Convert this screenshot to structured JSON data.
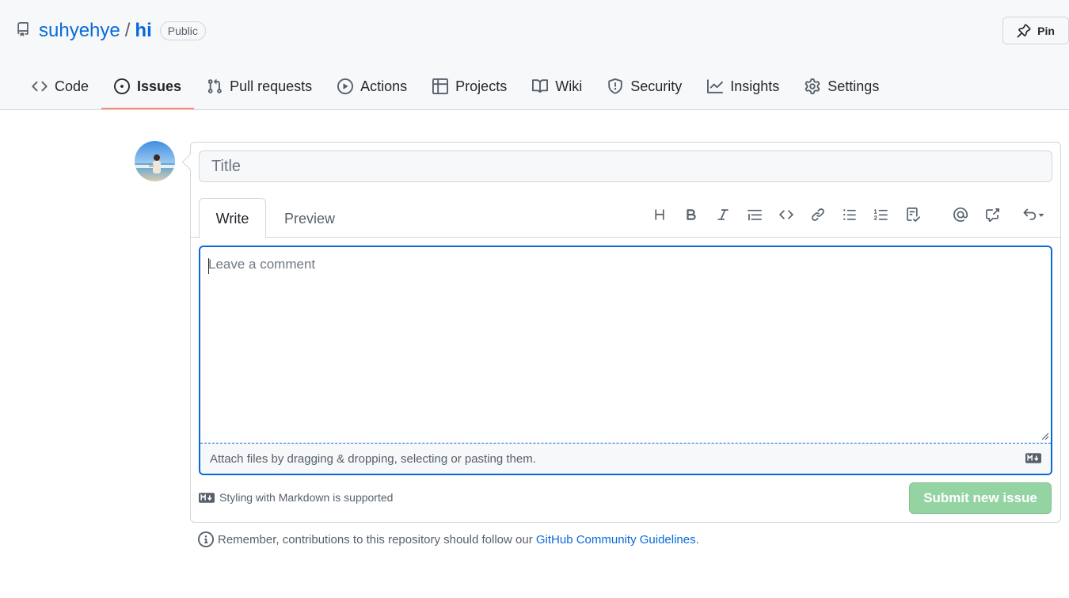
{
  "repo": {
    "owner": "suhyehye",
    "separator": "/",
    "name": "hi",
    "visibility": "Public",
    "pin_label": "Pin"
  },
  "nav": {
    "items": [
      {
        "label": "Code",
        "icon": "code-icon"
      },
      {
        "label": "Issues",
        "icon": "issue-opened-icon",
        "active": true
      },
      {
        "label": "Pull requests",
        "icon": "git-pull-request-icon"
      },
      {
        "label": "Actions",
        "icon": "play-icon"
      },
      {
        "label": "Projects",
        "icon": "table-icon"
      },
      {
        "label": "Wiki",
        "icon": "book-icon"
      },
      {
        "label": "Security",
        "icon": "shield-icon"
      },
      {
        "label": "Insights",
        "icon": "graph-icon"
      },
      {
        "label": "Settings",
        "icon": "gear-icon"
      }
    ]
  },
  "issue_form": {
    "title_placeholder": "Title",
    "tabs": {
      "write": "Write",
      "preview": "Preview"
    },
    "toolbar": [
      "heading-icon",
      "bold-icon",
      "italic-icon",
      "quote-icon",
      "code-icon",
      "link-icon",
      "bulleted-list-icon",
      "numbered-list-icon",
      "task-list-icon",
      "mention-icon",
      "cross-reference-icon",
      "undo-icon"
    ],
    "comment_placeholder": "Leave a comment",
    "attach_text": "Attach files by dragging & dropping, selecting or pasting them.",
    "markdown_note": "Styling with Markdown is supported",
    "submit_label": "Submit new issue"
  },
  "guidelines": {
    "prefix": "Remember, contributions to this repository should follow our",
    "link": "GitHub Community Guidelines",
    "suffix": "."
  },
  "colors": {
    "link": "#0969da",
    "active_tab_underline": "#fd8c73",
    "submit_disabled": "#94d3a2",
    "focus_border": "#0969da"
  }
}
